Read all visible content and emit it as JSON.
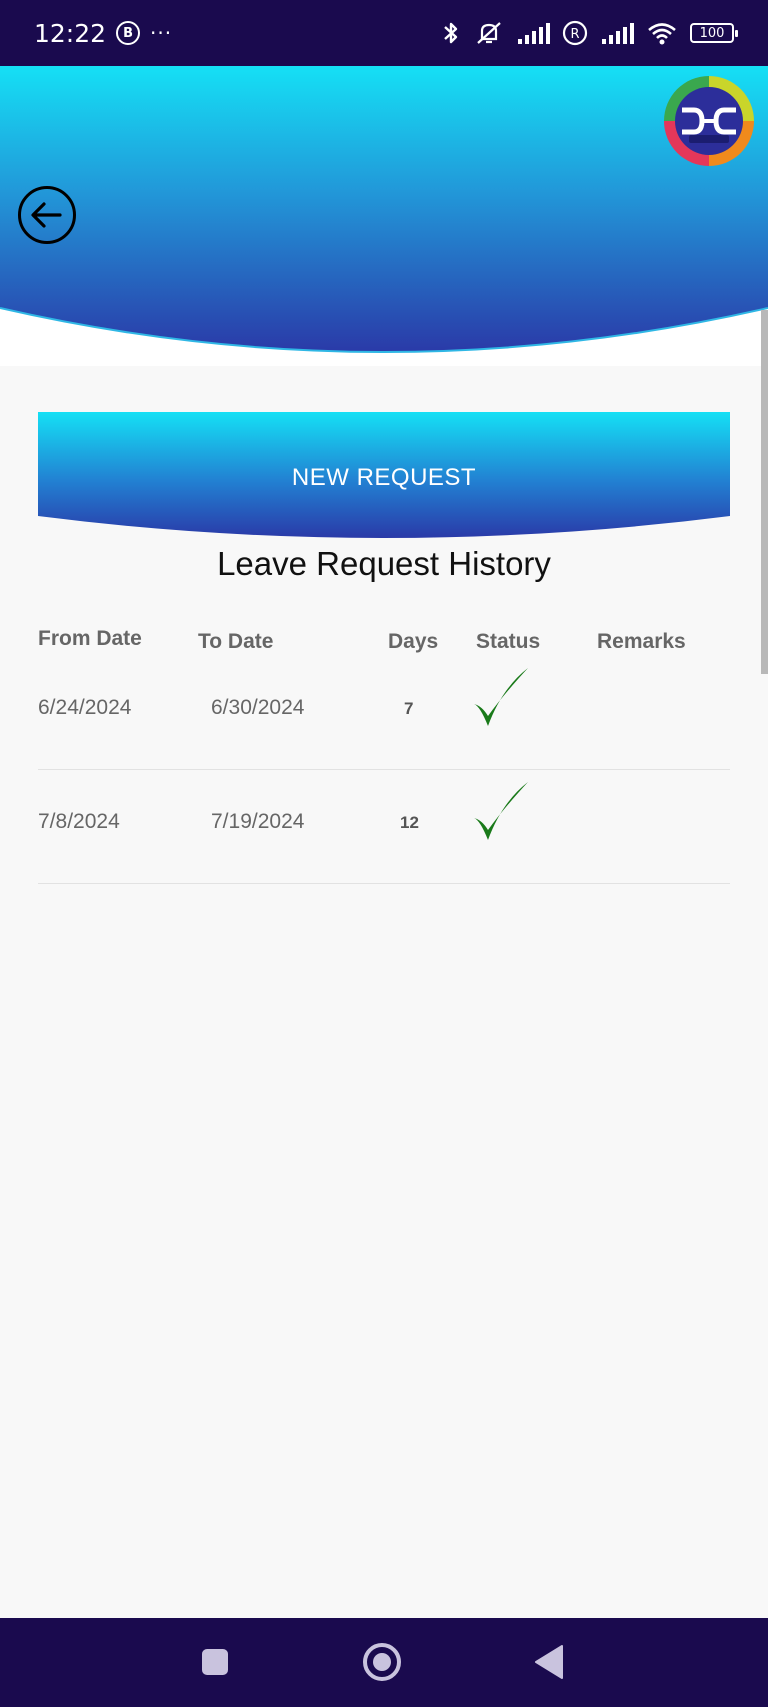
{
  "status_bar": {
    "time": "12:22",
    "b_badge": "B",
    "more": "···",
    "battery": "100"
  },
  "header": {
    "back_icon": "arrow-left-circle-icon",
    "logo_icon": "360-erp-logo",
    "gradient_top": "#15e0f5",
    "gradient_bottom": "#2a3aa8"
  },
  "actions": {
    "new_request_label": "NEW REQUEST"
  },
  "history": {
    "title": "Leave Request History",
    "columns": [
      "From Date",
      "To Date",
      "Days",
      "Status",
      "Remarks"
    ],
    "rows": [
      {
        "from": "6/24/2024",
        "to": "6/30/2024",
        "days": "7",
        "status": "approved",
        "remarks": ""
      },
      {
        "from": "7/8/2024",
        "to": "7/19/2024",
        "days": "12",
        "status": "approved",
        "remarks": ""
      }
    ]
  },
  "colors": {
    "system_bar": "#1a0a4e",
    "check_green": "#1a7a1a",
    "header_text": "#666666"
  }
}
